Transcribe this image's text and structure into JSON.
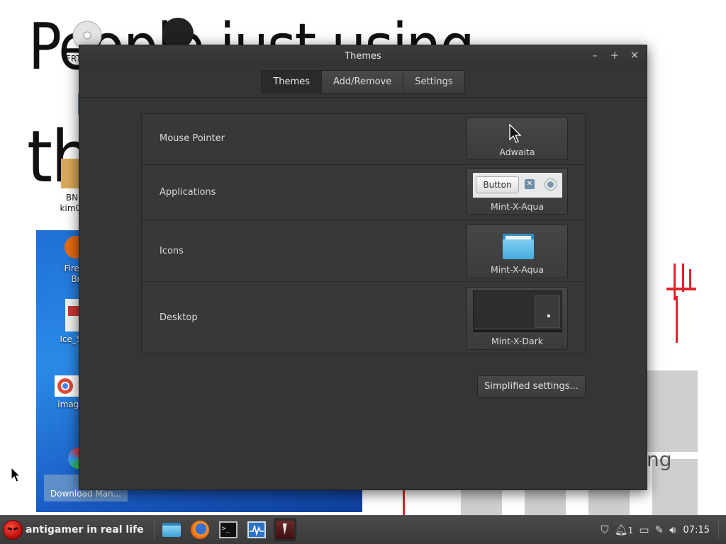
{
  "desktop": {
    "wallpaper_text_line1": "People just using",
    "wallpaper_text_line2": "the",
    "wallpaper_fragment": "ng",
    "icons": {
      "dvd_label": "FRTVMC...",
      "file_label": "F",
      "archive_label": "BN-L\nkim010",
      "firefox_label": "Firefo\nBr",
      "ice_label": "Ice_Ska",
      "image_label": "image_",
      "download_label": "Int\nDownload Man..."
    }
  },
  "window": {
    "title": "Themes",
    "tabs": [
      {
        "label": "Themes",
        "active": true
      },
      {
        "label": "Add/Remove",
        "active": false
      },
      {
        "label": "Settings",
        "active": false
      }
    ],
    "rows": [
      {
        "label": "Mouse Pointer",
        "value": "Adwaita"
      },
      {
        "label": "Applications",
        "value": "Mint-X-Aqua"
      },
      {
        "label": "Icons",
        "value": "Mint-X-Aqua"
      },
      {
        "label": "Desktop",
        "value": "Mint-X-Dark"
      }
    ],
    "app_preview_button": "Button",
    "simplified_button": "Simplified settings..."
  },
  "taskbar": {
    "menu_label": "antigamer in real life",
    "launchers": [
      "folder-icon",
      "firefox-icon",
      "terminal-icon",
      "system-monitor-icon",
      "antigamer-icon"
    ],
    "notification_count": "1",
    "clock": "07:15"
  },
  "colors": {
    "window_bg": "#353535",
    "accent_folder": "#45a9de",
    "taskbar_bg": "#3f3f3f"
  }
}
